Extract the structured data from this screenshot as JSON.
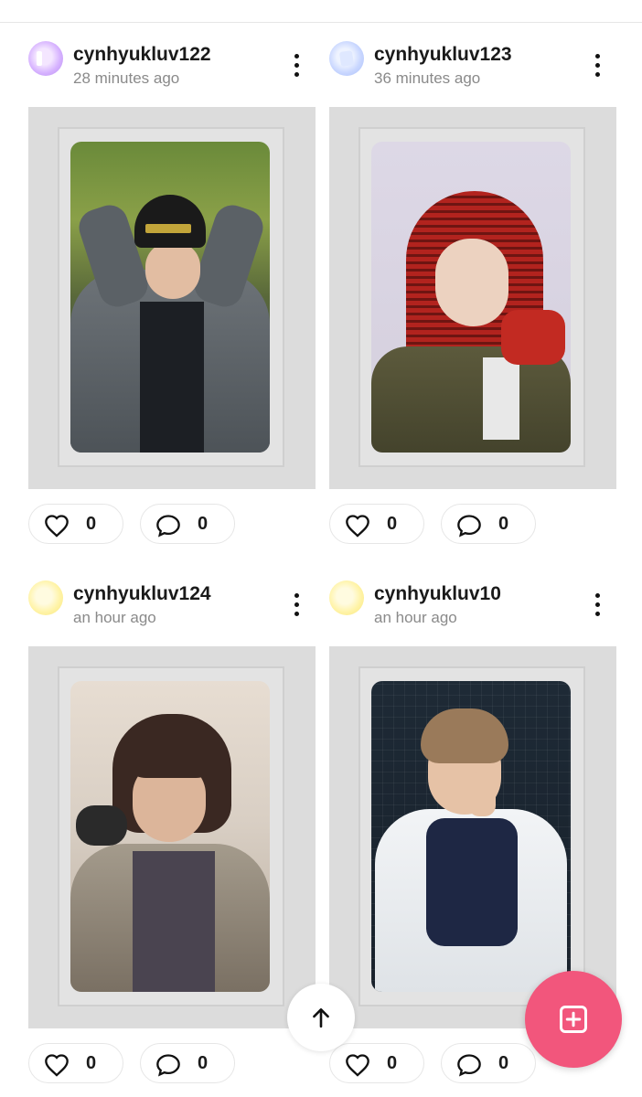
{
  "colors": {
    "accent": "#f2567c",
    "muted_text": "#8a8a8a",
    "frame_bg": "#dcdcdc"
  },
  "posts": [
    {
      "username": "cynhyukluv122",
      "time": "28 minutes ago",
      "likes": "0",
      "comments": "0",
      "avatar": "purple-avatar"
    },
    {
      "username": "cynhyukluv123",
      "time": "36 minutes ago",
      "likes": "0",
      "comments": "0",
      "avatar": "blue-avatar"
    },
    {
      "username": "cynhyukluv124",
      "time": "an hour ago",
      "likes": "0",
      "comments": "0",
      "avatar": "yellow-avatar"
    },
    {
      "username": "cynhyukluv10",
      "time": "an hour ago",
      "likes": "0",
      "comments": "0",
      "avatar": "yellow-avatar"
    }
  ],
  "icons": {
    "more": "kebab-icon",
    "like": "heart-icon",
    "comment": "comment-icon",
    "scroll_top": "arrow-up-icon",
    "create": "plus-square-icon"
  }
}
